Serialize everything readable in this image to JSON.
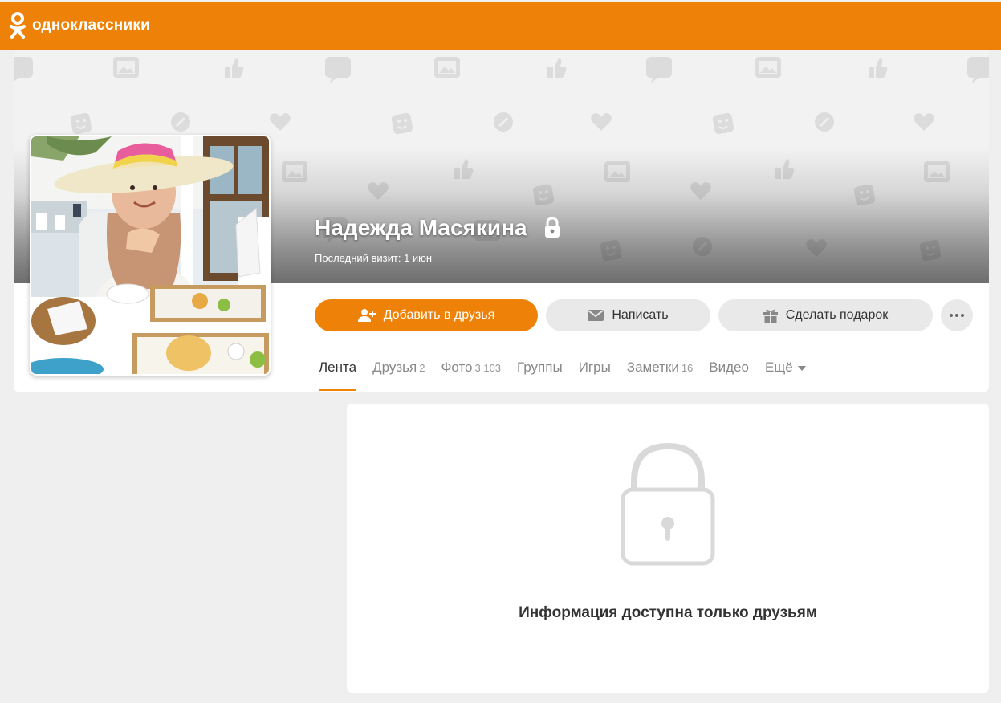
{
  "brand": {
    "name": "одноклассники"
  },
  "profile": {
    "name": "Надежда Масякина",
    "last_visit": "Последний визит: 1 июн"
  },
  "actions": {
    "add_friend": "Добавить в друзья",
    "message": "Написать",
    "gift": "Сделать подарок"
  },
  "tabs": [
    {
      "label": "Лента",
      "count": ""
    },
    {
      "label": "Друзья",
      "count": "2"
    },
    {
      "label": "Фото",
      "count": "3 103"
    },
    {
      "label": "Группы",
      "count": ""
    },
    {
      "label": "Игры",
      "count": ""
    },
    {
      "label": "Заметки",
      "count": "16"
    },
    {
      "label": "Видео",
      "count": ""
    },
    {
      "label": "Ещё",
      "count": ""
    }
  ],
  "privacy": {
    "message": "Информация доступна только друзьям"
  },
  "colors": {
    "accent": "#ee8208",
    "button_gray": "#e9e9e9",
    "background": "#efefef"
  }
}
